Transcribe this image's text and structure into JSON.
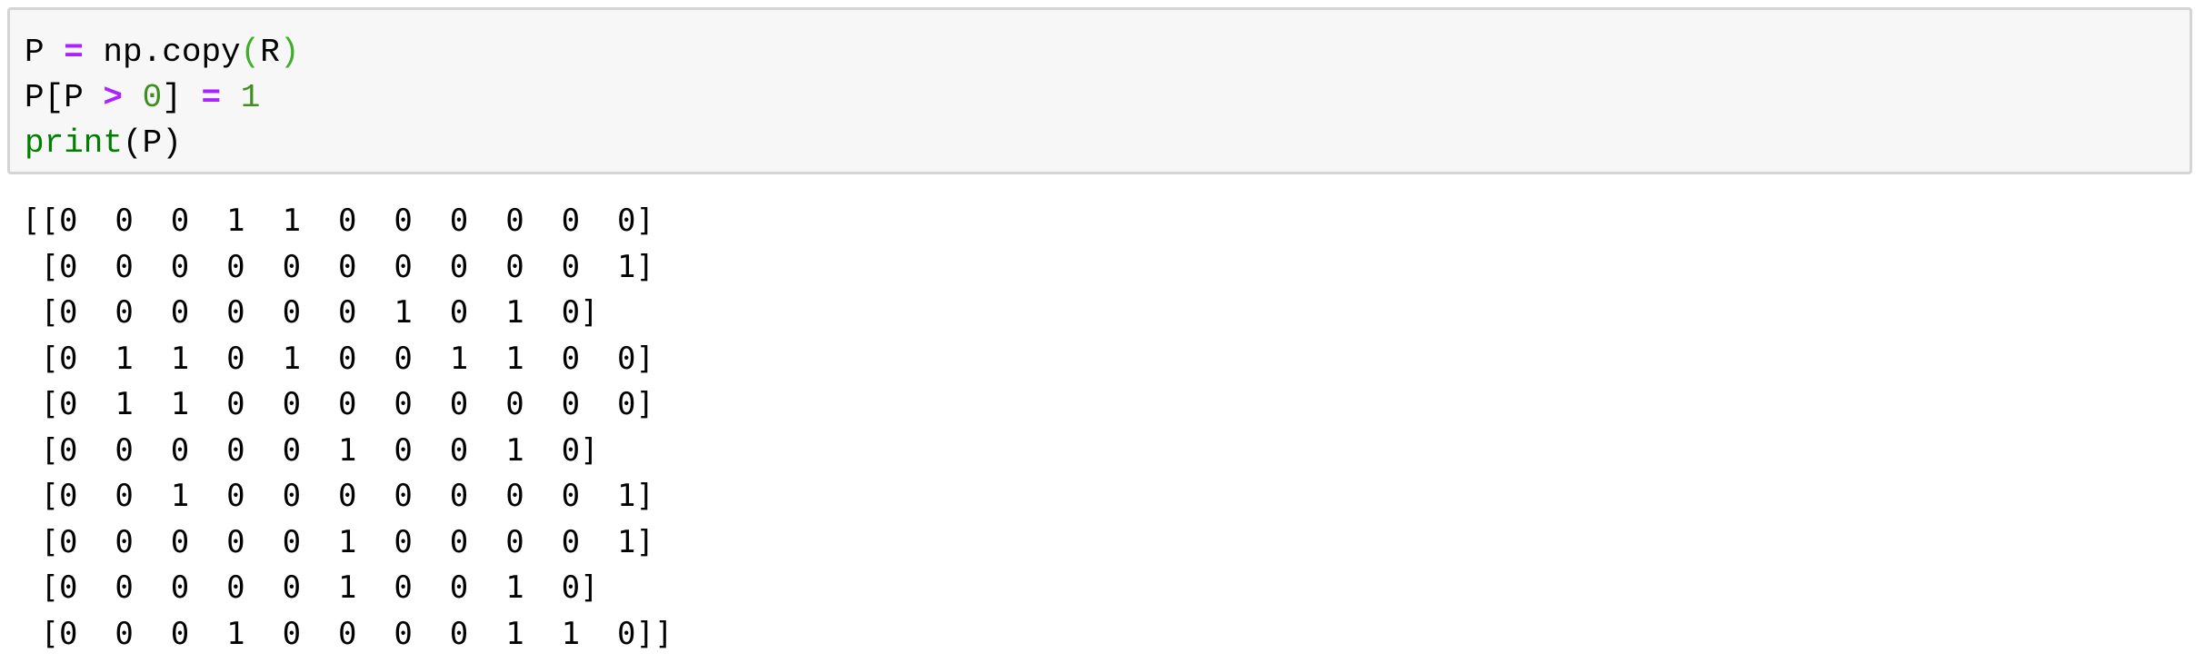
{
  "code_cell": {
    "lines": [
      {
        "tokens": [
          {
            "text": "P ",
            "kind": "plain"
          },
          {
            "text": "=",
            "kind": "op"
          },
          {
            "text": " np.copy",
            "kind": "plain"
          },
          {
            "text": "(",
            "kind": "paren"
          },
          {
            "text": "R",
            "kind": "plain"
          },
          {
            "text": ")",
            "kind": "paren"
          }
        ]
      },
      {
        "tokens": [
          {
            "text": "P[P ",
            "kind": "plain"
          },
          {
            "text": ">",
            "kind": "op"
          },
          {
            "text": " ",
            "kind": "plain"
          },
          {
            "text": "0",
            "kind": "num"
          },
          {
            "text": "] ",
            "kind": "plain"
          },
          {
            "text": "=",
            "kind": "op"
          },
          {
            "text": " ",
            "kind": "plain"
          },
          {
            "text": "1",
            "kind": "num"
          }
        ]
      },
      {
        "tokens": [
          {
            "text": "print",
            "kind": "builtin"
          },
          {
            "text": "(P)",
            "kind": "plain"
          }
        ]
      }
    ]
  },
  "output": {
    "lines": [
      "[[0  0  0  1  1  0  0  0  0  0  0]",
      " [0  0  0  0  0  0  0  0  0  0  1]",
      " [0  0  0  0  0  0  1  0  1  0]",
      " [0  1  1  0  1  0  0  1  1  0  0]",
      " [0  1  1  0  0  0  0  0  0  0  0]",
      " [0  0  0  0  0  1  0  0  1  0]",
      " [0  0  1  0  0  0  0  0  0  0  1]",
      " [0  0  0  0  0  1  0  0  0  0  1]",
      " [0  0  0  0  0  1  0  0  1  0]",
      " [0  0  0  1  0  0  0  0  1  1  0]]"
    ]
  },
  "colors": {
    "operator": "#aa22ff",
    "paren": "#3fae2a",
    "number": "#3f8f1f",
    "builtin": "#008000",
    "input_background": "#f7f7f7",
    "input_border": "#d4d4d4"
  }
}
